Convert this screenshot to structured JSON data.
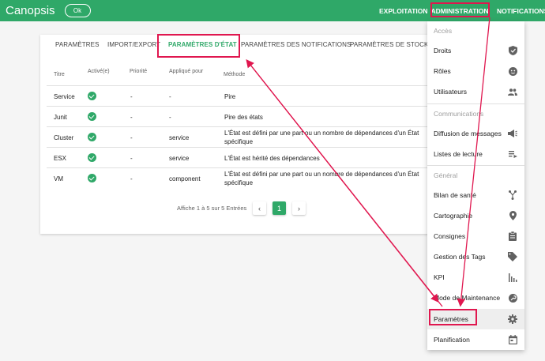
{
  "app": {
    "brand": "Canopsis",
    "ok_label": "Ok"
  },
  "nav": {
    "exploitation": "EXPLOITATION",
    "administration": "ADMINISTRATION",
    "notifications": "NOTIFICATIONS"
  },
  "tabs": [
    {
      "label": "PARAMÈTRES"
    },
    {
      "label": "IMPORT/EXPORT"
    },
    {
      "label": "PARAMÈTRES D'ÉTAT"
    },
    {
      "label": "PARAMÈTRES DES NOTIFICATIONS"
    },
    {
      "label": "PARAMÈTRES DE STOCKAGE"
    }
  ],
  "table": {
    "headers": {
      "title": "Titre",
      "enabled": "Activé(e)",
      "priority": "Priorité",
      "applied_for": "Appliqué pour",
      "method": "Méthode"
    },
    "rows": [
      {
        "title": "Service",
        "priority": "-",
        "applied_for": "-",
        "method": "Pire"
      },
      {
        "title": "Junit",
        "priority": "-",
        "applied_for": "-",
        "method": "Pire des états"
      },
      {
        "title": "Cluster",
        "priority": "-",
        "applied_for": "service",
        "method_line1": "L'État est défini par une part ou un nombre de dépendances d'un État",
        "method_line2": "spécifique"
      },
      {
        "title": "ESX",
        "priority": "-",
        "applied_for": "service",
        "method": "L'État est hérité des dépendances"
      },
      {
        "title": "VM",
        "priority": "-",
        "applied_for": "component",
        "method_line1": "L'État est défini par une part ou un nombre de dépendances d'un État",
        "method_line2": "spécifique"
      }
    ]
  },
  "pagination": {
    "summary": "Affiche 1 à 5 sur 5 Entrées",
    "prev": "‹",
    "current_page": "1",
    "next": "›"
  },
  "menu": {
    "sections": {
      "access": "Accès",
      "communications": "Communications",
      "general": "Général"
    },
    "items": {
      "droits": "Droits",
      "roles": "Rôles",
      "utilisateurs": "Utilisateurs",
      "diffusion": "Diffusion de messages",
      "listes": "Listes de lecture",
      "bilan": "Bilan de santé",
      "cartographie": "Cartographie",
      "consignes": "Consignes",
      "tags": "Gestion des Tags",
      "kpi": "KPI",
      "maintenance": "Mode de Maintenance",
      "parametres": "Paramètres",
      "planification": "Planification"
    }
  },
  "colors": {
    "brand": "#2fa868",
    "annotation": "#e0174f"
  }
}
